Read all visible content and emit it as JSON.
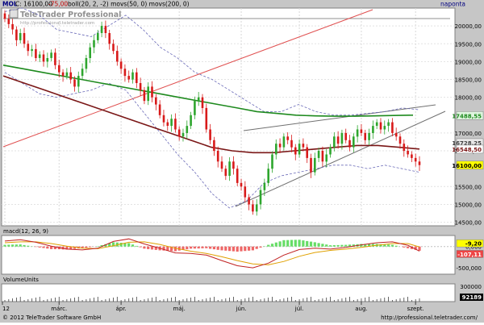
{
  "header": {
    "symbol": "MOL",
    "close_label": "C: 16100,00",
    "change_label": "-75,00",
    "indicators_label": "boll(20, 2, -2) movs(50, 0) movs(200, 0)",
    "period": "naponta"
  },
  "watermark": {
    "title": "TeleTrader Professional",
    "url": "http://professional.teletrader.com"
  },
  "footer": {
    "copyright": "© 2012 TeleTrader Software GmbH",
    "url": "http://professional.teletrader.com/"
  },
  "colors": {
    "background": "#c6c6c6",
    "plot_background": "#ffffff",
    "up_candle": "#2ea62e",
    "down_candle": "#d81a1a",
    "ma50": "#7a1616",
    "ma200": "#1e8a1e",
    "bollinger": "#6a6ab8",
    "trendline": "#e05050",
    "triangle": "#707070",
    "price_tag": "#ffff00",
    "macd_line": "#c02020",
    "signal_line": "#e0a000",
    "hist_positive": "#66dd66",
    "hist_negative": "#ee6666"
  },
  "chart_data": [
    {
      "type": "candlestick",
      "title": "MOL",
      "period": "naponta",
      "x_labels": [
        "12",
        "márc.",
        "ápr.",
        "máj.",
        "jún.",
        "júl.",
        "aug.",
        "szept."
      ],
      "y_ticks": [
        "20000,00",
        "19500,00",
        "19000,00",
        "18500,00",
        "18000,00",
        "17000,00",
        "16500,00",
        "15500,00",
        "15000,00",
        "14500,00"
      ],
      "ylim": [
        14400,
        20500
      ],
      "price_tags": [
        {
          "label": "17488,55",
          "value": 17488.55,
          "style": "green"
        },
        {
          "label": "16728,25",
          "value": 16728.25,
          "style": "gray"
        },
        {
          "label": "16548,50",
          "value": 16548.5,
          "style": "red"
        },
        {
          "label": "16100,00",
          "value": 16100,
          "style": "yellow"
        }
      ],
      "horizontal_line": 20000,
      "close": [
        20200,
        20050,
        19900,
        19600,
        19800,
        19500,
        19300,
        19350,
        19100,
        19200,
        19000,
        19100,
        19250,
        18900,
        18700,
        18600,
        18700,
        18500,
        18300,
        18600,
        18800,
        19100,
        19400,
        19600,
        19800,
        20000,
        19800,
        19500,
        19300,
        19000,
        18800,
        18600,
        18500,
        18700,
        18400,
        18200,
        17900,
        18300,
        18000,
        17800,
        17500,
        17300,
        17200,
        17400,
        17100,
        16900,
        17000,
        17200,
        17500,
        17900,
        18000,
        17700,
        17100,
        16800,
        16500,
        16200,
        16000,
        15800,
        16200,
        16000,
        15600,
        15500,
        15200,
        15000,
        14800,
        15000,
        15400,
        15600,
        16000,
        16400,
        16700,
        16600,
        16900,
        16800,
        16600,
        16400,
        16700,
        16600,
        16300,
        15900,
        16300,
        16500,
        16200,
        16400,
        16600,
        16900,
        16700,
        17000,
        16800,
        16600,
        16900,
        17100,
        17000,
        16800,
        17000,
        17200,
        17300,
        17100,
        17200,
        17300,
        17000,
        16900,
        16700,
        16500,
        16400,
        16300,
        16200,
        16100
      ],
      "series": [
        {
          "name": "movs(50, 0)",
          "y": [
            18600,
            18400,
            18200,
            18000,
            17800,
            17600,
            17400,
            17200,
            17000,
            16800,
            16600,
            16500,
            16450,
            16450,
            16500,
            16550,
            16600,
            16650,
            16650,
            16600,
            16550
          ]
        },
        {
          "name": "movs(200, 0)",
          "y": [
            18900,
            18800,
            18700,
            18600,
            18500,
            18400,
            18300,
            18200,
            18100,
            18000,
            17900,
            17800,
            17700,
            17600,
            17550,
            17500,
            17480,
            17470,
            17470,
            17480,
            17490,
            17500
          ]
        },
        {
          "name": "boll(20, 2, -2) upper",
          "y": [
            20400,
            20500,
            20300,
            19900,
            19800,
            19700,
            20000,
            20300,
            19900,
            19400,
            19100,
            18700,
            18500,
            18200,
            17900,
            17600,
            17600,
            17800,
            17600,
            17500,
            17500,
            17550,
            17600,
            17700,
            17650
          ]
        },
        {
          "name": "boll(20, 2, -2) lower",
          "y": [
            18700,
            18400,
            18100,
            18000,
            18100,
            18200,
            18400,
            18200,
            17600,
            17000,
            16400,
            15900,
            15300,
            14900,
            15100,
            15600,
            15800,
            15900,
            16000,
            16100,
            16100,
            16000,
            16100,
            16000,
            15900
          ]
        }
      ]
    },
    {
      "type": "line",
      "title": "macd(12, 26, 9)",
      "y_ticks": [
        "0,000",
        "-500,000"
      ],
      "ylim": [
        -650,
        260
      ],
      "price_tags": [
        {
          "label": "-9,20",
          "value": -9.2,
          "style": "yellow"
        },
        {
          "label": "-107,11",
          "value": -107.11,
          "style": "red"
        }
      ],
      "x": [
        0,
        4,
        8,
        12,
        16,
        20,
        24,
        28,
        32,
        36,
        40,
        44,
        48,
        52,
        56,
        60,
        64,
        68,
        72,
        76,
        80,
        84,
        88,
        92,
        96,
        100,
        104,
        107
      ],
      "series": [
        {
          "name": "macd",
          "y": [
            130,
            160,
            100,
            10,
            -60,
            -80,
            -40,
            120,
            180,
            60,
            -40,
            -150,
            -160,
            -200,
            -330,
            -450,
            -500,
            -390,
            -200,
            -70,
            -40,
            -60,
            -20,
            40,
            90,
            110,
            30,
            -107
          ]
        },
        {
          "name": "signal",
          "y": [
            90,
            110,
            110,
            70,
            10,
            -40,
            -50,
            20,
            100,
            110,
            50,
            -40,
            -110,
            -160,
            -240,
            -330,
            -410,
            -430,
            -350,
            -230,
            -140,
            -90,
            -60,
            -20,
            30,
            70,
            70,
            -9
          ]
        },
        {
          "name": "histogram",
          "y": [
            40,
            50,
            -10,
            -60,
            -70,
            -40,
            10,
            100,
            80,
            -50,
            -90,
            -110,
            -50,
            -40,
            -90,
            -120,
            -90,
            40,
            150,
            160,
            100,
            30,
            40,
            60,
            60,
            40,
            -40,
            -98
          ]
        }
      ]
    },
    {
      "type": "bar",
      "title": "VolumeUnits",
      "y_ticks": [
        "300000",
        "0"
      ],
      "price_tags": [
        {
          "label": "92189",
          "value": 92189,
          "style": "black"
        }
      ]
    }
  ]
}
